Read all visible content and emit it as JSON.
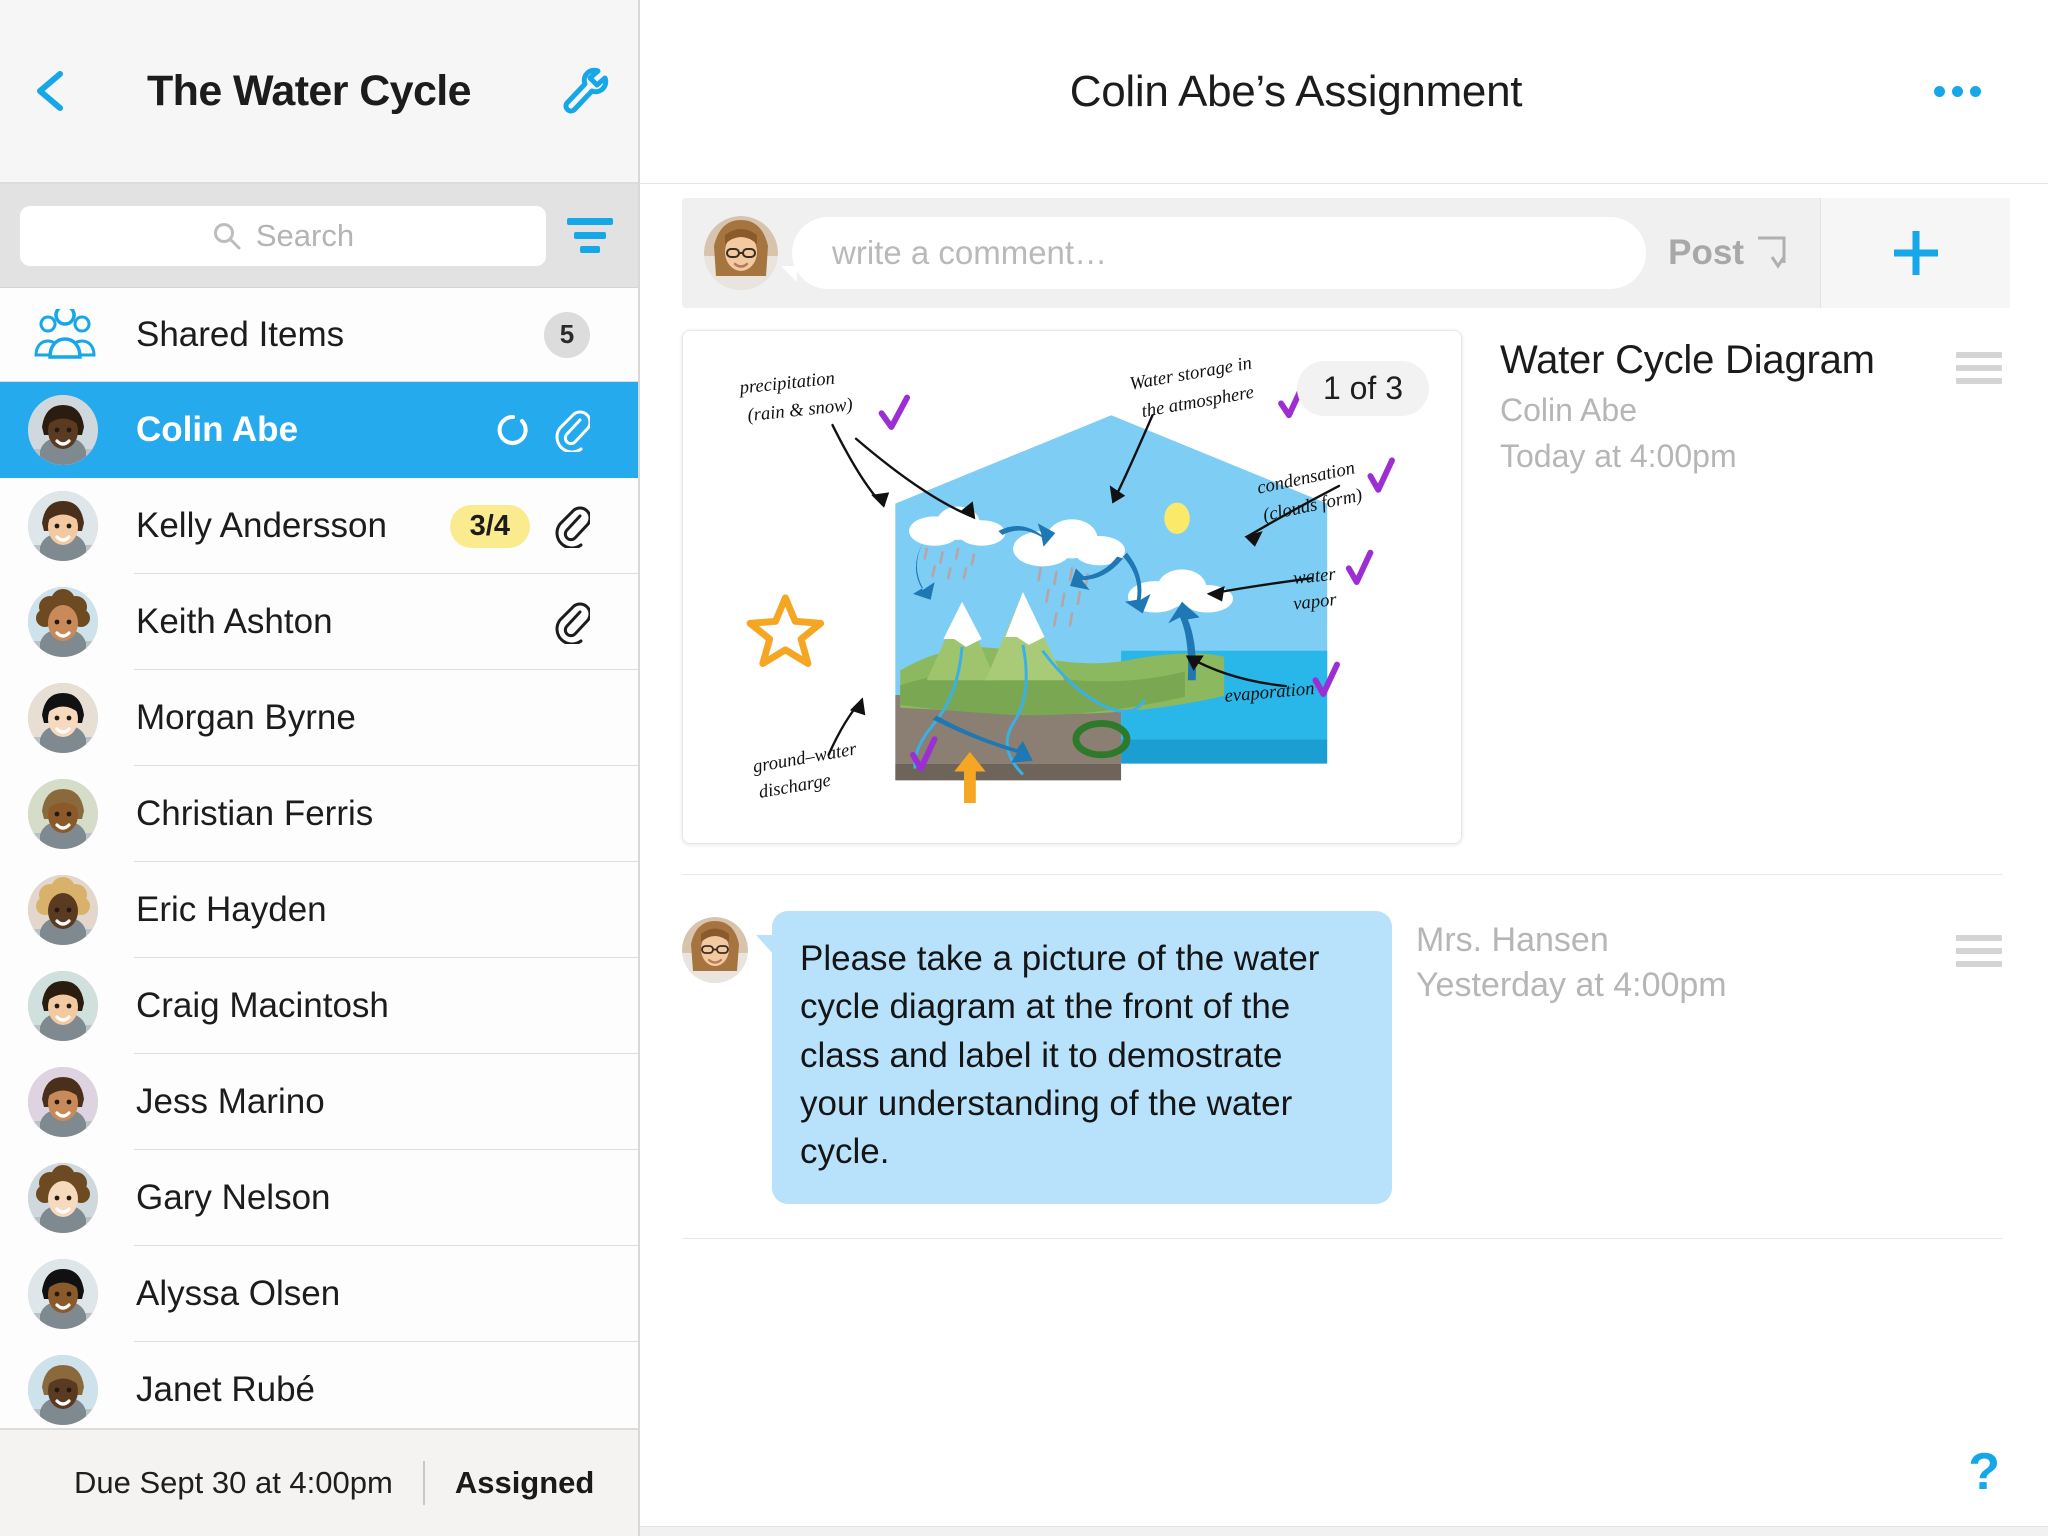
{
  "sidebar": {
    "back_icon": "chevron-left-icon",
    "title": "The Water Cycle",
    "settings_icon": "wrench-icon",
    "search": {
      "placeholder": "Search",
      "value": "",
      "icon": "search-icon"
    },
    "filter_icon": "filter-icon",
    "shared_items": {
      "label": "Shared Items",
      "count": "5",
      "icon": "people-icon"
    },
    "students": [
      {
        "name": "Colin Abe",
        "selected": true,
        "badge": "",
        "ring": true,
        "clip": true
      },
      {
        "name": "Kelly Andersson",
        "selected": false,
        "badge": "3/4",
        "ring": false,
        "clip": true
      },
      {
        "name": "Keith Ashton",
        "selected": false,
        "badge": "",
        "ring": false,
        "clip": true
      },
      {
        "name": "Morgan Byrne",
        "selected": false,
        "badge": "",
        "ring": false,
        "clip": false
      },
      {
        "name": "Christian Ferris",
        "selected": false,
        "badge": "",
        "ring": false,
        "clip": false
      },
      {
        "name": "Eric Hayden",
        "selected": false,
        "badge": "",
        "ring": false,
        "clip": false
      },
      {
        "name": "Craig Macintosh",
        "selected": false,
        "badge": "",
        "ring": false,
        "clip": false
      },
      {
        "name": "Jess Marino",
        "selected": false,
        "badge": "",
        "ring": false,
        "clip": false
      },
      {
        "name": "Gary Nelson",
        "selected": false,
        "badge": "",
        "ring": false,
        "clip": false
      },
      {
        "name": "Alyssa Olsen",
        "selected": false,
        "badge": "",
        "ring": false,
        "clip": false
      },
      {
        "name": "Janet Rubé",
        "selected": false,
        "badge": "",
        "ring": false,
        "clip": false
      }
    ],
    "footer": {
      "due": "Due Sept 30 at 4:00pm",
      "status": "Assigned"
    }
  },
  "main": {
    "title": "Colin Abe’s Assignment",
    "more_icon": "ellipsis-icon",
    "compose": {
      "placeholder": "write a comment…",
      "value": "",
      "post_label": "Post",
      "post_icon": "return-arrow-icon",
      "add_icon": "plus-icon",
      "avatar_name": "avatar-teacher"
    },
    "attachment": {
      "page_indicator": "1 of 3",
      "title": "Water Cycle Diagram",
      "author": "Colin Abe",
      "timestamp": "Today at 4:00pm",
      "drag_icon": "drag-handle-icon",
      "diagram_labels": [
        "precipitation (rain & snow)",
        "water storage in the atmosphere",
        "condensation (clouds form)",
        "water vapor",
        "evaporation",
        "ground-water discharge"
      ]
    },
    "comment": {
      "text": "Please take a picture of the water cycle diagram at the front of the class and label it to demostrate your understanding of the water cycle.",
      "author": "Mrs. Hansen",
      "timestamp": "Yesterday at 4:00pm",
      "drag_icon": "drag-handle-icon"
    },
    "help_label": "?"
  },
  "colors": {
    "accent": "#16a7e8",
    "selected_row": "#26aaee",
    "bubble": "#b8e2fb",
    "badge_yellow": "#fbeb8f",
    "check_purple": "#9b2fd4",
    "star_orange": "#f9a battery"
  }
}
